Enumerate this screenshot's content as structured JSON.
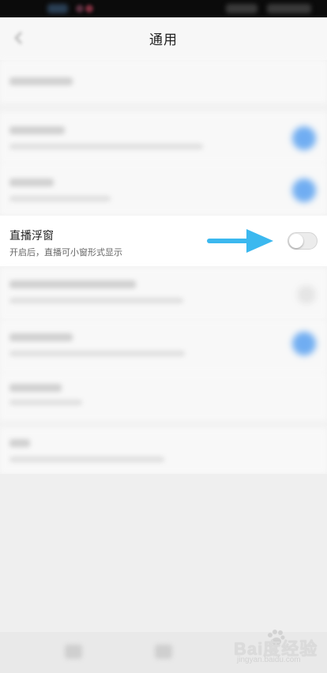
{
  "header": {
    "title": "通用"
  },
  "focused_setting": {
    "title": "直播浮窗",
    "subtitle": "开启后，直播可小窗形式显示",
    "enabled": false
  },
  "watermark": {
    "brand": "Bai度经验",
    "url": "jingyan.baidu.com"
  },
  "colors": {
    "accent": "#5aa2f2",
    "arrow": "#3bb8ef"
  }
}
